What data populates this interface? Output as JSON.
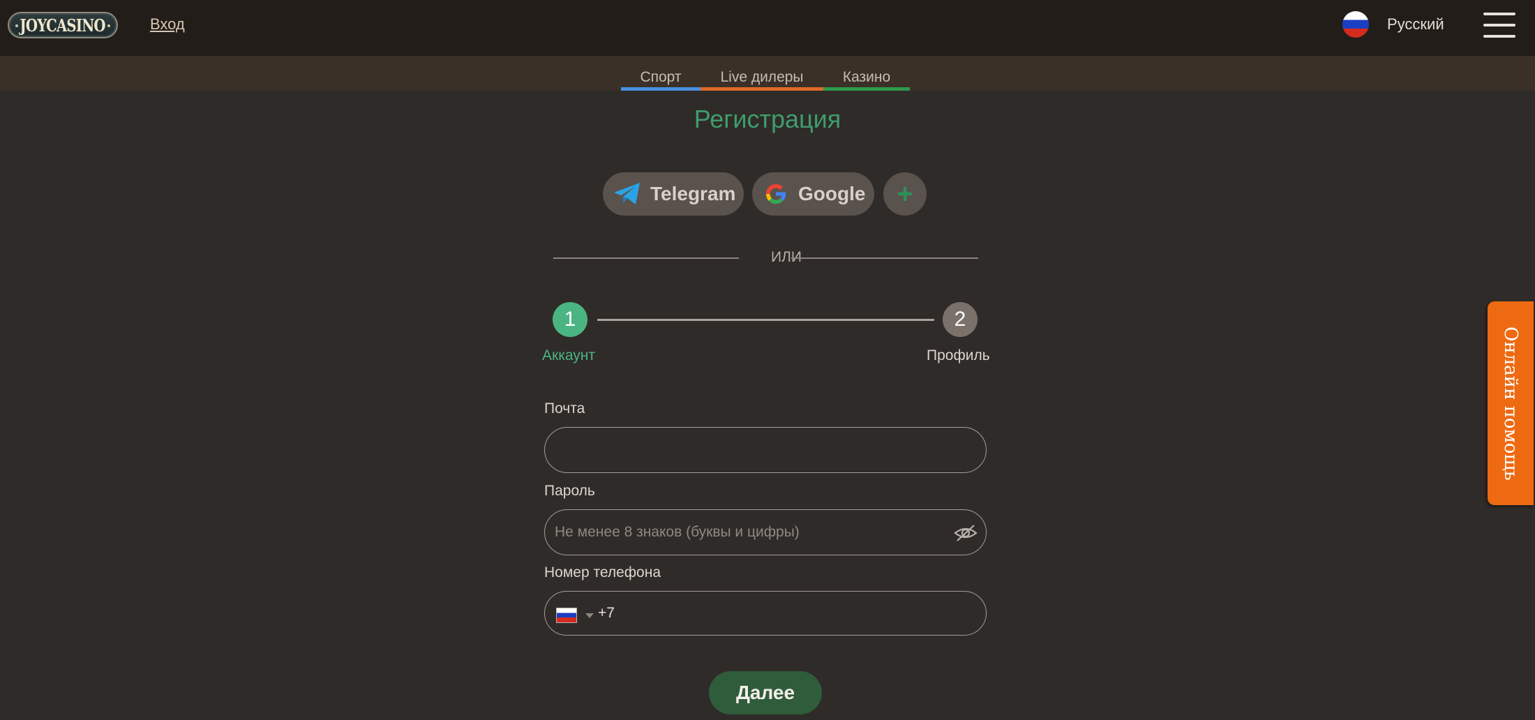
{
  "header": {
    "logo_text": "JOYCASINO",
    "login_label": "Вход",
    "language_label": "Русский",
    "language_flag_icon": "russia-flag-icon",
    "menu_icon": "hamburger-menu-icon"
  },
  "categories": [
    {
      "label": "Спорт",
      "color": "#4a8fe0"
    },
    {
      "label": "Live дилеры",
      "color": "#e06a2a"
    },
    {
      "label": "Казино",
      "color": "#2e9a4a"
    }
  ],
  "registration": {
    "title": "Регистрация",
    "social_buttons": [
      {
        "label": "Telegram",
        "icon": "telegram-icon"
      },
      {
        "label": "Google",
        "icon": "google-icon"
      }
    ],
    "more_button_icon": "plus-icon",
    "divider_text": "ИЛИ",
    "steps": [
      {
        "number": "1",
        "label": "Аккаунт",
        "active": true
      },
      {
        "number": "2",
        "label": "Профиль",
        "active": false
      }
    ],
    "email": {
      "label": "Почта",
      "value": "",
      "placeholder": ""
    },
    "password": {
      "label": "Пароль",
      "value": "",
      "placeholder": "Не менее 8 знаков (буквы и цифры)",
      "toggle_icon": "eye-hidden-icon"
    },
    "phone": {
      "label": "Номер телефона",
      "country_flag_icon": "russia-flag-icon",
      "value": "+7"
    },
    "next_label": "Далее"
  },
  "help_tab": {
    "label": "Онлайн помощь"
  },
  "colors": {
    "accent_green": "#3f9d6b",
    "active_step": "#4bb582",
    "inactive_step": "#7a716b",
    "button_dark_green": "#2f5c3a",
    "help_orange": "#ee6a12"
  }
}
